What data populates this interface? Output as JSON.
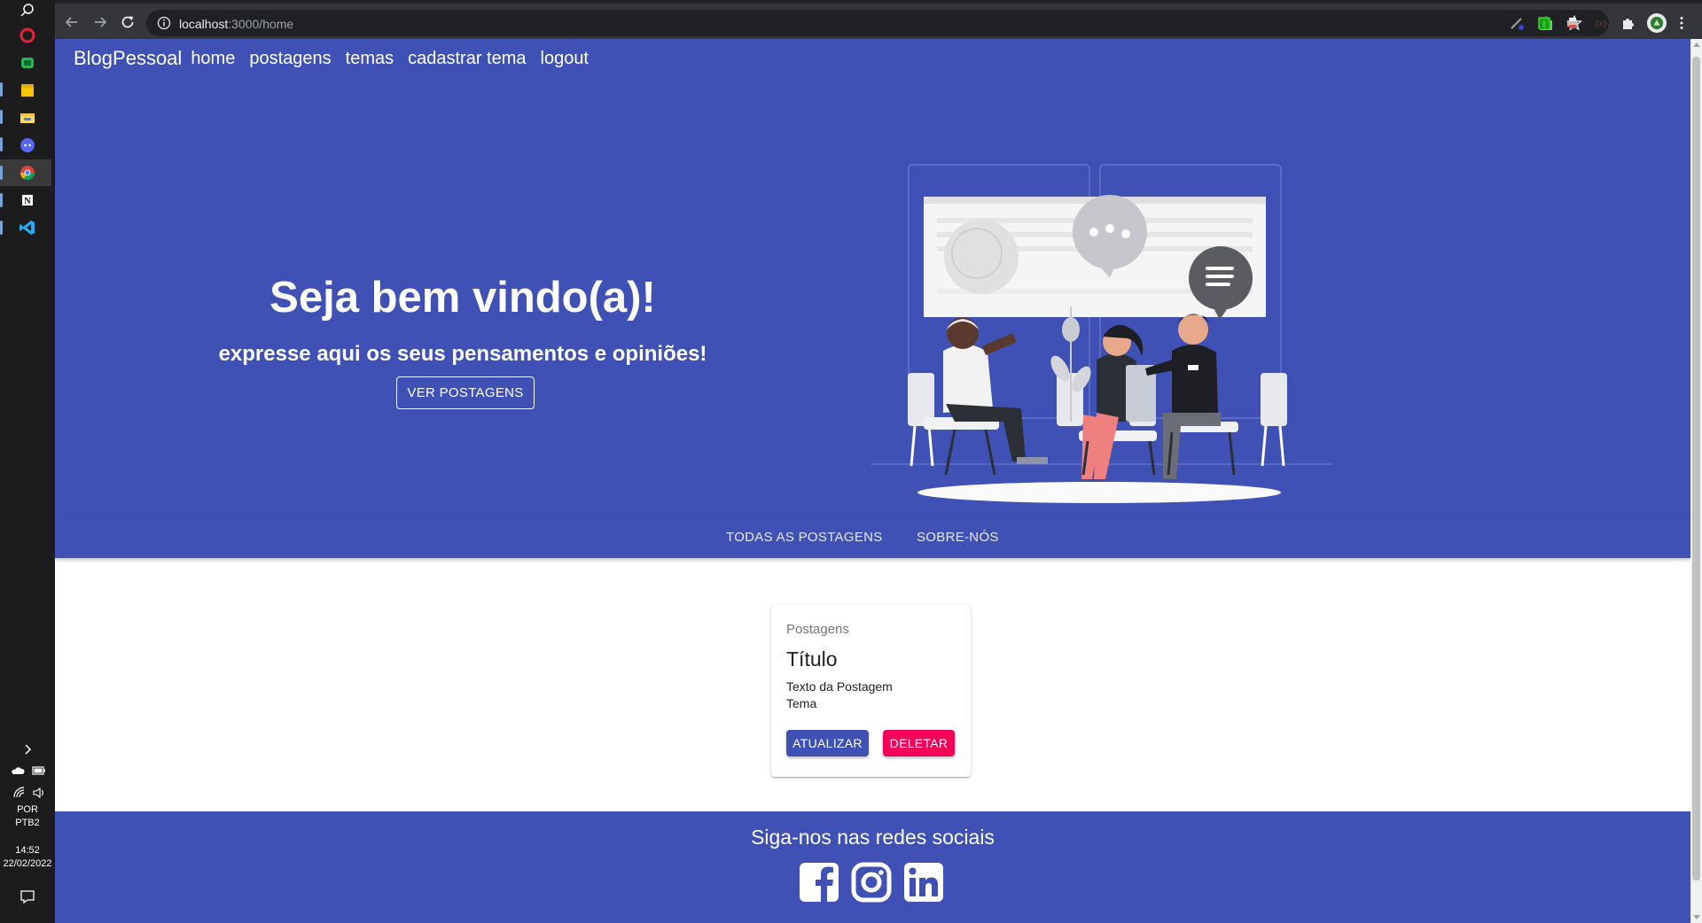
{
  "taskbar": {
    "language_line1": "POR",
    "language_line2": "PTB2",
    "time": "14:52",
    "date": "22/02/2022"
  },
  "browser": {
    "url_host": "localhost",
    "url_rest": ":3000/home"
  },
  "navbar": {
    "brand": "BlogPessoal",
    "links": [
      "home",
      "postagens",
      "temas",
      "cadastrar tema",
      "logout"
    ]
  },
  "hero": {
    "title": "Seja bem vindo(a)!",
    "subtitle": "expresse aqui os seus pensamentos e opiniões!",
    "button": "VER POSTAGENS"
  },
  "tabs": [
    "TODAS AS POSTAGENS",
    "SOBRE-NÓS"
  ],
  "card": {
    "overline": "Postagens",
    "title": "Título",
    "text": "Texto da Postagem",
    "tema": "Tema",
    "update_button": "ATUALIZAR",
    "delete_button": "DELETAR"
  },
  "footer": {
    "title": "Siga-nos nas redes sociais",
    "icons": [
      "facebook-icon",
      "instagram-icon",
      "linkedin-icon"
    ]
  },
  "colors": {
    "primary": "#3f51b5",
    "secondary": "#f50057"
  }
}
